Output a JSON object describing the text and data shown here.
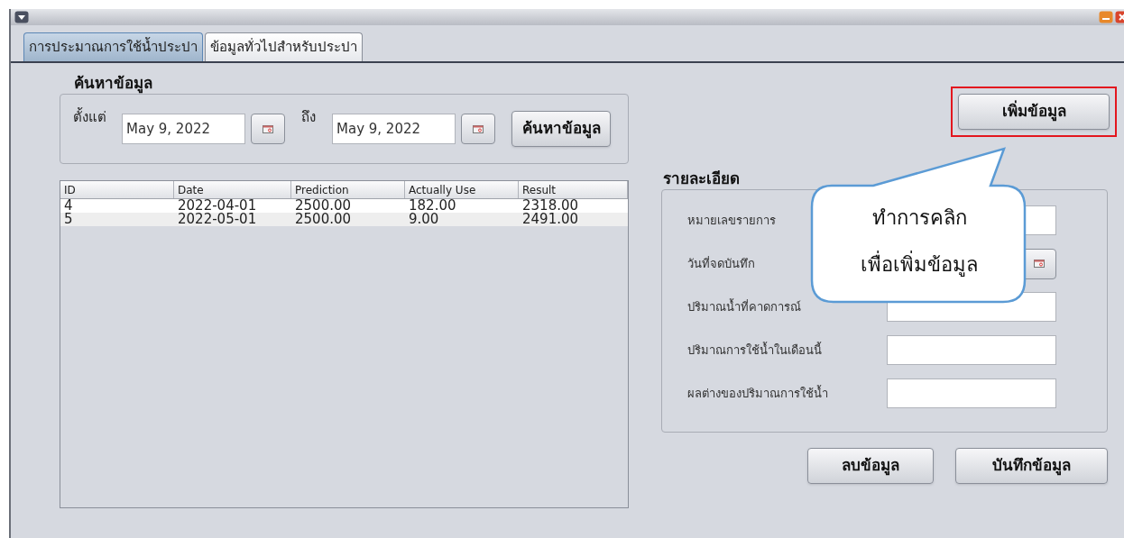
{
  "tabs": [
    {
      "label": "การประมาณการใช้น้ำประปา",
      "selected": true
    },
    {
      "label": "ข้อมูลทั่วไปสำหรับประปา",
      "selected": false
    }
  ],
  "search": {
    "title": "ค้นหาข้อมูล",
    "from_label": "ตั้งแต่",
    "from_value": "May 9, 2022",
    "to_label": "ถึง",
    "to_value": "May 9, 2022",
    "button": "ค้นหาข้อมูล"
  },
  "table": {
    "columns": [
      "ID",
      "Date",
      "Prediction",
      "Actually Use",
      "Result"
    ],
    "rows": [
      [
        "4",
        "2022-04-01",
        "2500.00",
        "182.00",
        "2318.00"
      ],
      [
        "5",
        "2022-05-01",
        "2500.00",
        "9.00",
        "2491.00"
      ]
    ]
  },
  "add_button": {
    "label": "เพิ่มข้อมูล",
    "highlighted": true
  },
  "details": {
    "title": "รายละเอียด",
    "fields": [
      {
        "label": "หมายเลขรายการ",
        "kind": "text"
      },
      {
        "label": "วันที่จดบันทึก",
        "kind": "date"
      },
      {
        "label": "ปริมาณน้ำที่คาดการณ์",
        "kind": "text"
      },
      {
        "label": "ปริมาณการใช้น้ำในเดือนนี้",
        "kind": "text"
      },
      {
        "label": "ผลต่างของปริมาณการใช้น้ำ",
        "kind": "text"
      }
    ]
  },
  "buttons": [
    "ลบข้อมูล",
    "บันทึกข้อมูล"
  ],
  "callout": {
    "lines": [
      "ทำการคลิก",
      "เพื่อเพิ่มข้อมูล"
    ]
  }
}
